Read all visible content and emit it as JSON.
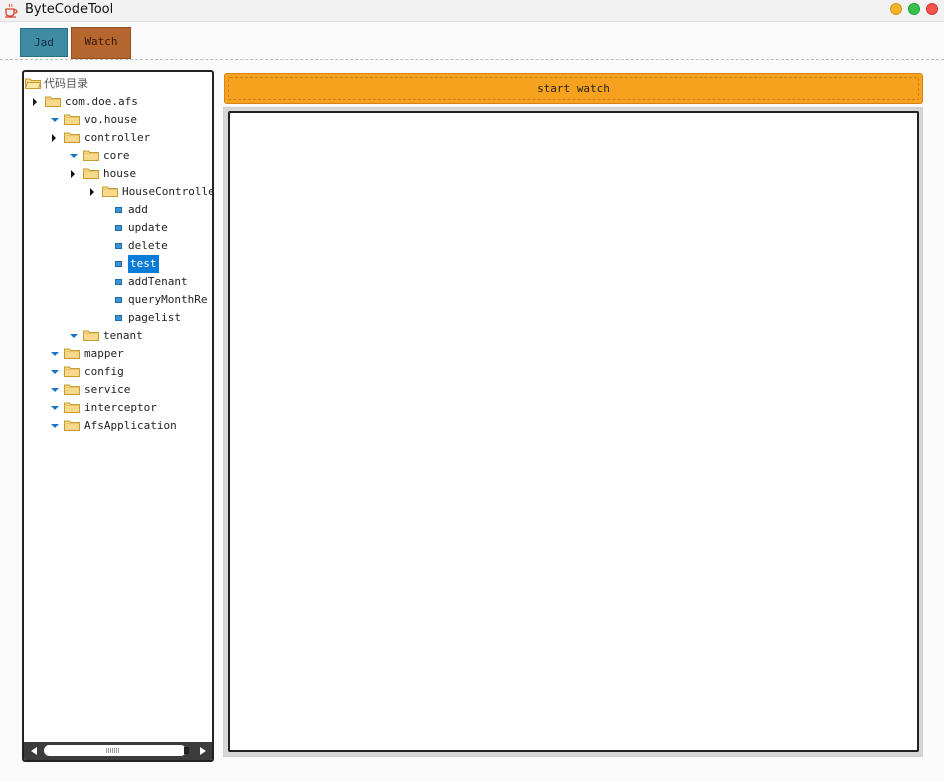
{
  "window": {
    "title": "ByteCodeTool",
    "icon": "java-coffee-cup-icon"
  },
  "tabs": [
    {
      "label": "Jad",
      "color": "#3f8ba3"
    },
    {
      "label": "Watch",
      "color": "#b5672f",
      "active": true
    }
  ],
  "tree": {
    "root_label": "代码目录",
    "nodes": [
      {
        "label": "com.doe.afs",
        "expanded": false
      },
      {
        "label": "vo.house",
        "expanded": true
      },
      {
        "label": "controller",
        "expanded": false
      },
      {
        "label": "core",
        "expanded": true
      },
      {
        "label": "house",
        "expanded": false
      },
      {
        "label": "HouseController",
        "expanded": false
      },
      {
        "label": "add",
        "type": "method"
      },
      {
        "label": "update",
        "type": "method"
      },
      {
        "label": "delete",
        "type": "method"
      },
      {
        "label": "test",
        "type": "method",
        "selected": true
      },
      {
        "label": "addTenant",
        "type": "method"
      },
      {
        "label": "queryMonthRe",
        "type": "method"
      },
      {
        "label": "pagelist",
        "type": "method"
      },
      {
        "label": "tenant",
        "expanded": true
      },
      {
        "label": "mapper",
        "expanded": true
      },
      {
        "label": "config",
        "expanded": true
      },
      {
        "label": "service",
        "expanded": true
      },
      {
        "label": "interceptor",
        "expanded": true
      },
      {
        "label": "AfsApplication",
        "expanded": true
      }
    ]
  },
  "actions": {
    "start_watch_label": "start watch",
    "start_watch_color": "#f7a21f"
  },
  "output": {
    "text": ""
  },
  "colors": {
    "selection": "#0a7bd6",
    "expand_arrow": "#1b73c8"
  }
}
